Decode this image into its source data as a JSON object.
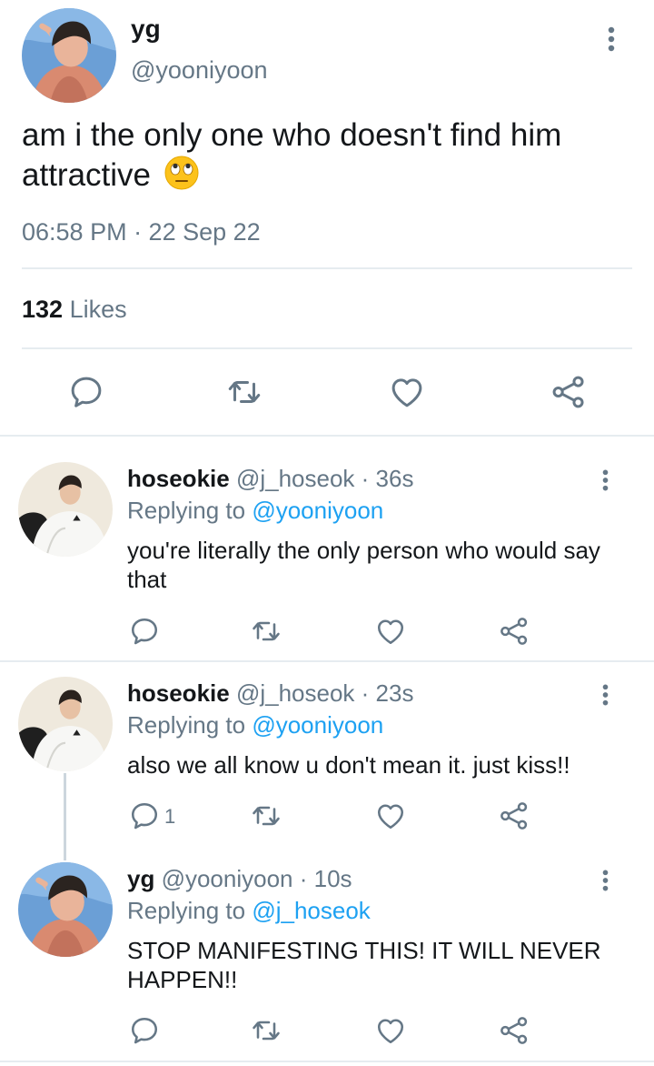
{
  "main_tweet": {
    "name": "yg",
    "handle": "@yooniyoon",
    "text": "am i the only one who doesn't find him attractive",
    "time": "06:58 PM · 22 Sep 22",
    "likes_count": "132",
    "likes_label": "Likes",
    "avatar_icon": "user-avatar-photo",
    "emoji_icon": "face-with-rolling-eyes-emoji"
  },
  "replies": [
    {
      "name": "hoseokie",
      "handle": "@j_hoseok",
      "age": "· 36s",
      "replying_prefix": "Replying to",
      "replying_to": "@yooniyoon",
      "text": "you're literally the only person who would say that",
      "reply_count": ""
    },
    {
      "name": "hoseokie",
      "handle": "@j_hoseok",
      "age": "· 23s",
      "replying_prefix": "Replying to",
      "replying_to": "@yooniyoon",
      "text": "also we all know u don't mean it. just kiss!!",
      "reply_count": "1"
    },
    {
      "name": "yg",
      "handle": "@yooniyoon",
      "age": "· 10s",
      "replying_prefix": "Replying to",
      "replying_to": "@j_hoseok",
      "text": "STOP MANIFESTING THIS! IT WILL NEVER HAPPEN!!",
      "reply_count": ""
    }
  ],
  "colors": {
    "link_blue": "#1da1f2",
    "secondary_grey": "#657786",
    "divider": "#e6ecf0"
  }
}
